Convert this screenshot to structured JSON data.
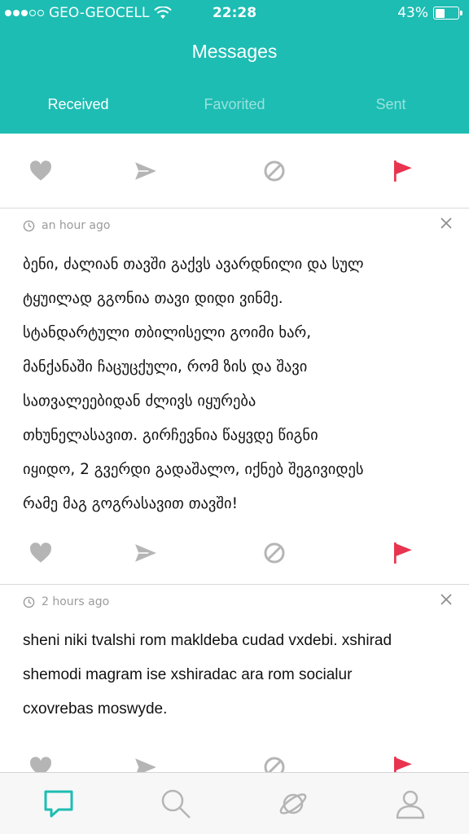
{
  "status_bar": {
    "carrier": "GEO-GEOCELL",
    "time": "22:28",
    "battery": "43%",
    "battery_level": 0.43,
    "signal_bars": 3,
    "signal_total": 5
  },
  "header": {
    "title": "Messages",
    "tabs": [
      "Received",
      "Favorited",
      "Sent"
    ],
    "active_tab": "Received",
    "color": "#1dbdb3"
  },
  "messages": [
    {
      "time": "an hour ago",
      "lines": [
        "ბენი, ძალიან თავში გაქვს ავარდნილი და სულ",
        "ტყუილად გგონია თავი დიდი ვინმე.",
        "სტანდარტული თბილისელი გოიმი ხარ,",
        "მანქანაში ჩაცუცქული, რომ ზის და შავი",
        "სათვალეებიდან ძლივს იყურება",
        "თხუნელასავით. გირჩევნია წაყვდე წიგნი",
        "იყიდო, 2 გვერდი გადაშალო, იქნებ შეგივიდეს",
        "რამე მაგ გოგრასავით თავში!"
      ]
    },
    {
      "time": "2 hours ago",
      "lines": [
        "sheni niki tvalshi rom makldeba cudad vxdebi. xshirad",
        "shemodi magram ise xshiradac ara rom socialur",
        "cxovrebas moswyde."
      ]
    }
  ],
  "colors": {
    "flag": "#e8344f",
    "icon_gray": "#b5b5b5",
    "tabbar_active": "#1dbdb3",
    "tabbar_inactive": "#b5b5b5"
  },
  "tabbar": [
    "messages-icon",
    "search-icon",
    "planet-icon",
    "profile-icon"
  ]
}
